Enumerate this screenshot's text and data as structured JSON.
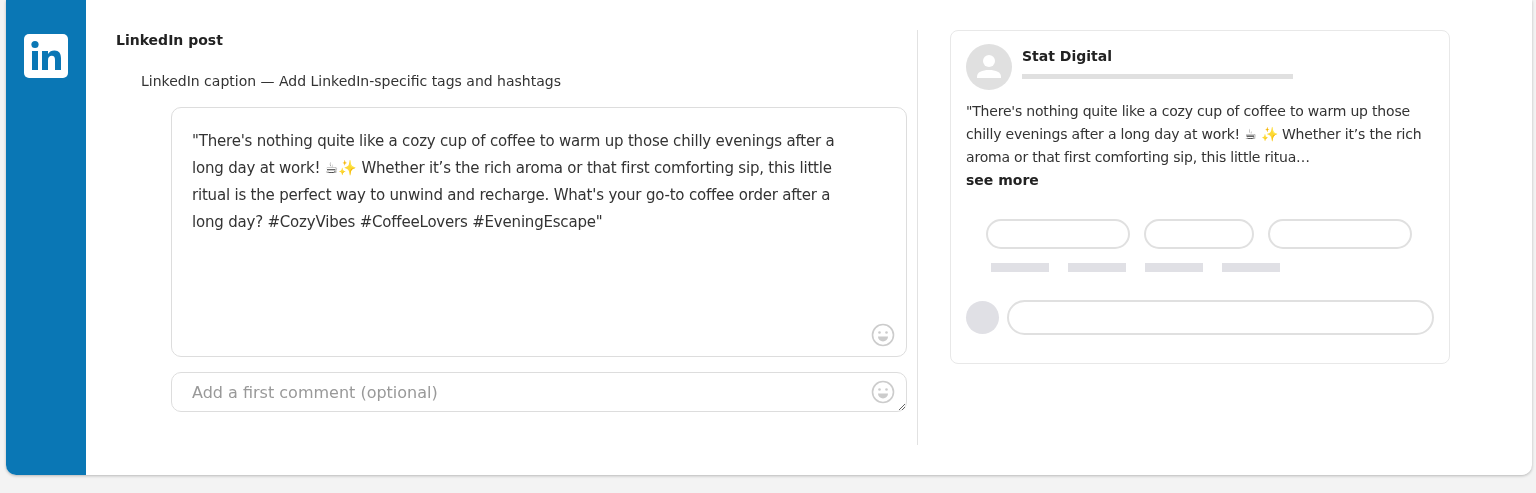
{
  "section": {
    "title": "LinkedIn post"
  },
  "caption": {
    "label": "LinkedIn caption — Add LinkedIn-specific tags and hashtags",
    "value": "\"There's nothing quite like a cozy cup of coffee to warm up those chilly evenings after a long day at work! ☕✨ Whether it’s the rich aroma or that first comforting sip, this little ritual is the perfect way to unwind and recharge. What's your go-to coffee order after a long day? #CozyVibes #CoffeeLovers #EveningEscape\""
  },
  "first_comment": {
    "placeholder": "Add a first comment (optional)"
  },
  "preview": {
    "account": "Stat Digital",
    "text": "\"There's nothing quite like a cozy cup of coffee to warm up those chilly evenings after a long day at work! ☕ ✨ Whether it’s the rich aroma or that first comforting sip, this little ritua…",
    "see_more": "see more"
  }
}
